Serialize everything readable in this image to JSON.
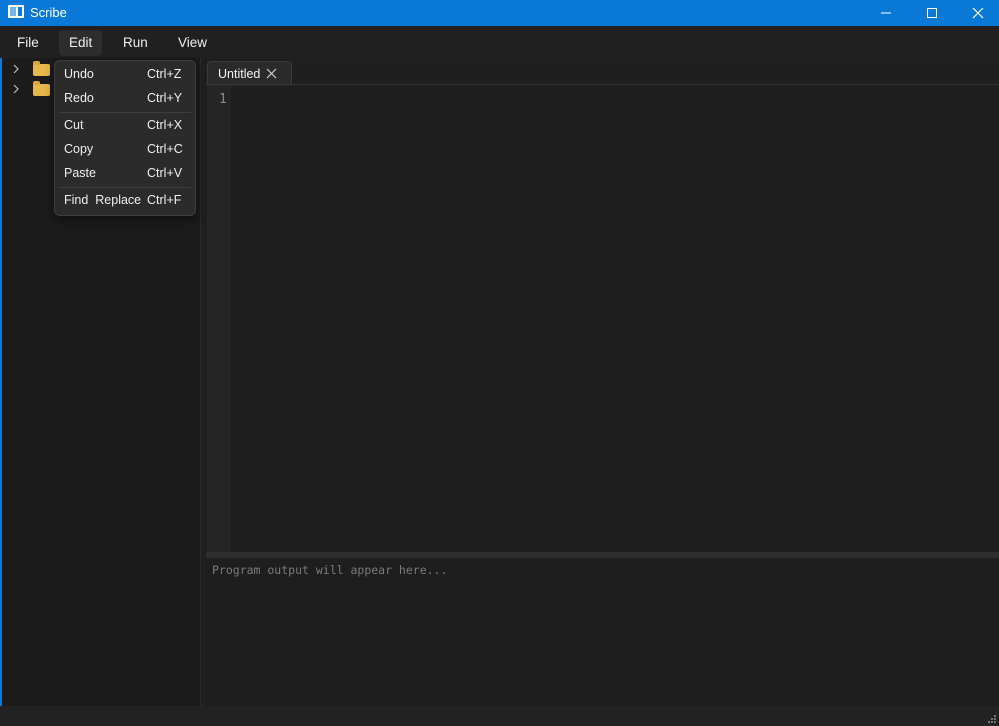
{
  "window": {
    "title": "Scribe",
    "icon": "app-icon",
    "controls": [
      "minimize-icon",
      "maximize-icon",
      "close-icon"
    ]
  },
  "menubar": {
    "file": "File",
    "edit": "Edit",
    "run": "Run",
    "view": "View",
    "active": "Edit"
  },
  "edit_menu": {
    "undo": {
      "label": "Undo",
      "shortcut": "Ctrl+Z"
    },
    "redo": {
      "label": "Redo",
      "shortcut": "Ctrl+Y"
    },
    "cut": {
      "label": "Cut",
      "shortcut": "Ctrl+X"
    },
    "copy": {
      "label": "Copy",
      "shortcut": "Ctrl+C"
    },
    "paste": {
      "label": "Paste",
      "shortcut": "Ctrl+V"
    },
    "find_replace": {
      "label": "Find  Replace",
      "shortcut": "Ctrl+F"
    }
  },
  "sidebar": {
    "items": [
      {
        "icon": "folder-icon",
        "expand": "chevron-right-icon"
      },
      {
        "icon": "folder-icon",
        "expand": "chevron-right-icon"
      }
    ]
  },
  "editor": {
    "tab": {
      "label": "Untitled",
      "close": "close-icon"
    },
    "line_numbers": [
      "1"
    ],
    "content": ""
  },
  "output": {
    "placeholder": "Program output will appear here..."
  },
  "colors": {
    "titlebar": "#0a78d7",
    "background": "#1c1c1c",
    "menu_bg": "#2b2b2b",
    "folder": "#e6b84a"
  }
}
